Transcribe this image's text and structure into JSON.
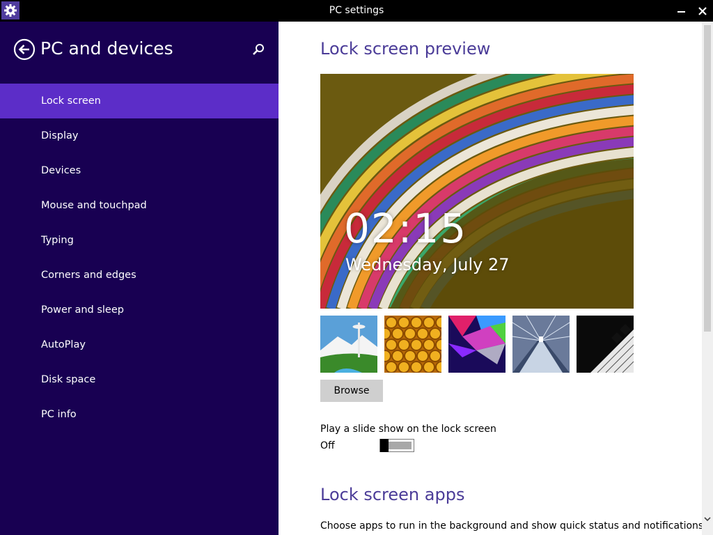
{
  "window": {
    "title": "PC settings",
    "app_icon": "gear-icon",
    "minimize_icon": "minimize-icon",
    "close_icon": "close-icon"
  },
  "sidebar": {
    "title": "PC and devices",
    "back_icon": "back-arrow-icon",
    "search_icon": "search-icon",
    "background_color": "#180052",
    "selected_color": "#5c2dc8",
    "items": [
      {
        "label": "Lock screen",
        "selected": true
      },
      {
        "label": "Display",
        "selected": false
      },
      {
        "label": "Devices",
        "selected": false
      },
      {
        "label": "Mouse and touchpad",
        "selected": false
      },
      {
        "label": "Typing",
        "selected": false
      },
      {
        "label": "Corners and edges",
        "selected": false
      },
      {
        "label": "Power and sleep",
        "selected": false
      },
      {
        "label": "AutoPlay",
        "selected": false
      },
      {
        "label": "Disk space",
        "selected": false
      },
      {
        "label": "PC info",
        "selected": false
      }
    ]
  },
  "main": {
    "heading_color": "#4b3c98",
    "preview_heading": "Lock screen preview",
    "preview": {
      "time": "02:15",
      "date": "Wednesday, July 27"
    },
    "thumbnails": [
      {
        "name": "space-needle-thumbnail"
      },
      {
        "name": "honeycomb-thumbnail"
      },
      {
        "name": "geometric-shapes-thumbnail"
      },
      {
        "name": "escalator-thumbnail"
      },
      {
        "name": "piano-keys-thumbnail"
      }
    ],
    "browse_label": "Browse",
    "slideshow_label": "Play a slide show on the lock screen",
    "slideshow_state": "Off",
    "apps_heading": "Lock screen apps",
    "apps_description": "Choose apps to run in the background and show quick status and notifications,"
  }
}
